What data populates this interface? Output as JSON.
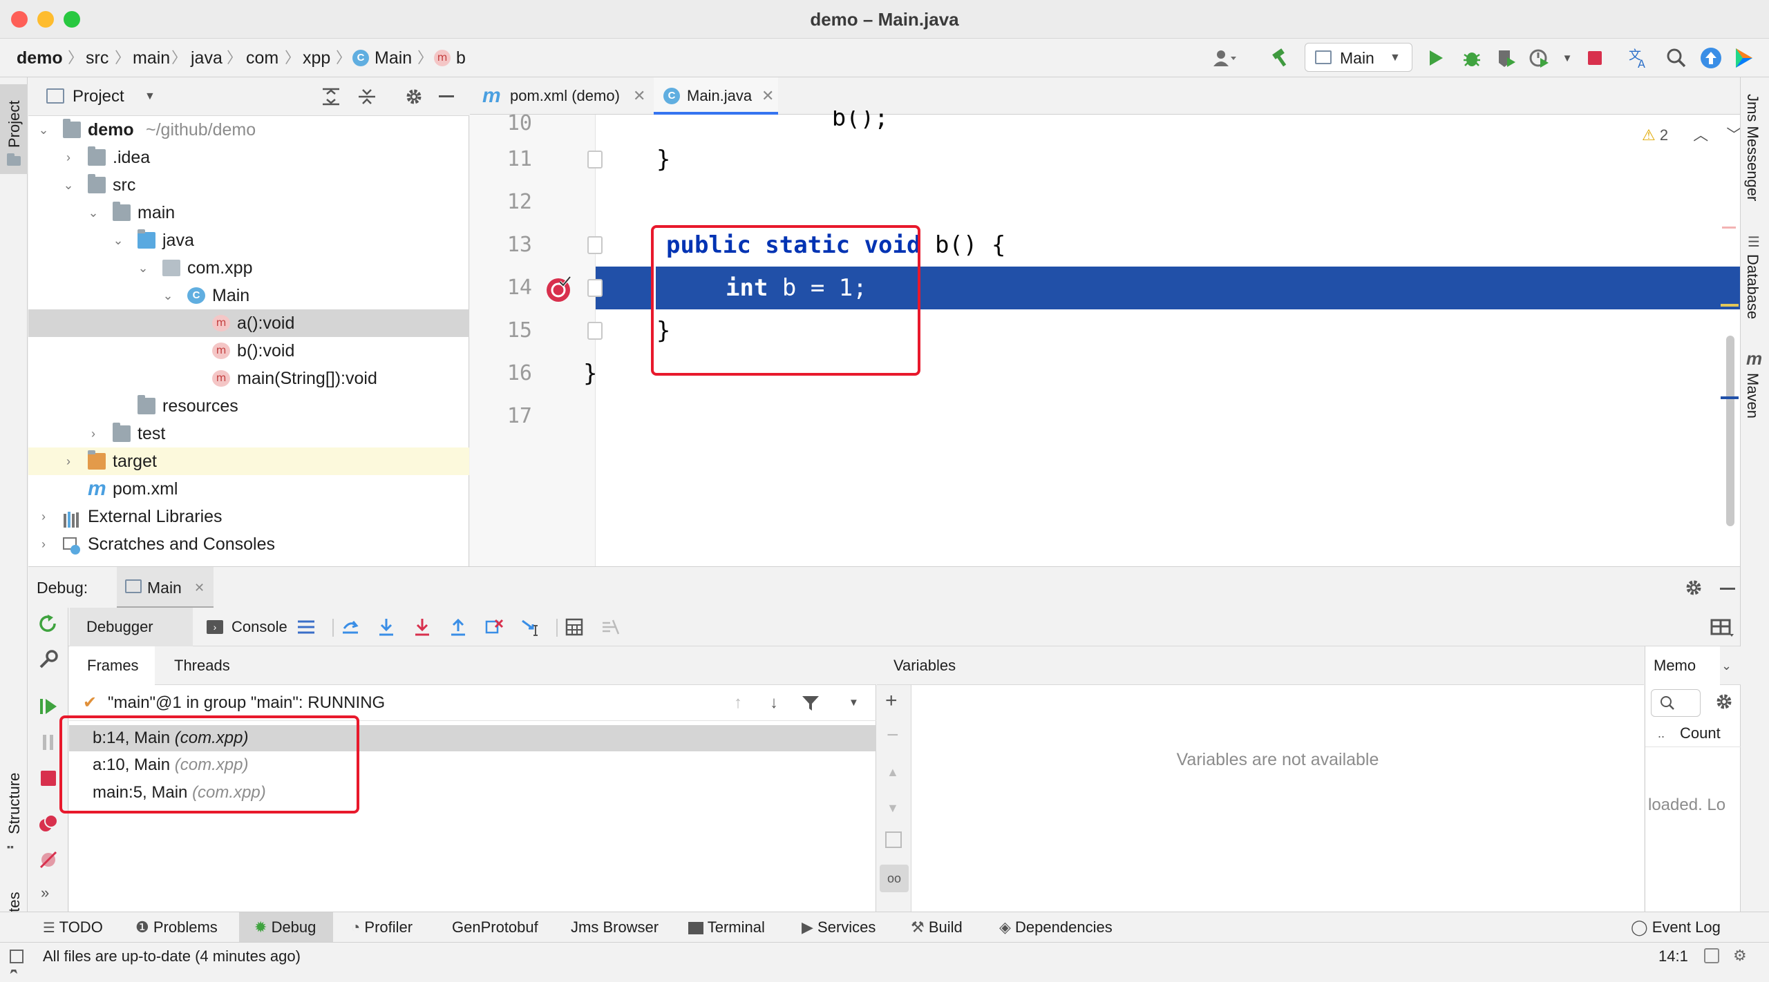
{
  "window": {
    "title": "demo – Main.java"
  },
  "breadcrumbs": [
    "demo",
    "src",
    "main",
    "java",
    "com",
    "xpp",
    "Main",
    "b"
  ],
  "toolbar": {
    "run_config": "Main"
  },
  "project_panel": {
    "title": "Project",
    "tree": [
      {
        "label": "demo",
        "suffix": "~/github/demo"
      },
      {
        "label": ".idea"
      },
      {
        "label": "src"
      },
      {
        "label": "main"
      },
      {
        "label": "java"
      },
      {
        "label": "com.xpp"
      },
      {
        "label": "Main"
      },
      {
        "label": "a():void"
      },
      {
        "label": "b():void"
      },
      {
        "label": "main(String[]):void"
      },
      {
        "label": "resources"
      },
      {
        "label": "test"
      },
      {
        "label": "target"
      },
      {
        "label": "pom.xml"
      },
      {
        "label": "External Libraries"
      },
      {
        "label": "Scratches and Consoles"
      }
    ]
  },
  "editor": {
    "tabs": [
      {
        "label": "pom.xml (demo)",
        "icon": "maven-file-icon"
      },
      {
        "label": "Main.java",
        "icon": "java-class-icon",
        "active": true
      }
    ],
    "warnings_count": "2",
    "lines": [
      {
        "num": "10",
        "code": "        b();"
      },
      {
        "num": "11",
        "code": "    }"
      },
      {
        "num": "12",
        "code": ""
      },
      {
        "num": "13",
        "kw": "public static void",
        "code": " b() {"
      },
      {
        "num": "14",
        "kw": "int",
        "code": " b = 1;"
      },
      {
        "num": "15",
        "code": "    }"
      },
      {
        "num": "16",
        "code": "}"
      },
      {
        "num": "17",
        "code": ""
      }
    ]
  },
  "debug": {
    "label": "Debug:",
    "session_tab": "Main",
    "tabs": {
      "debugger": "Debugger",
      "console": "Console"
    },
    "subtabs": {
      "frames": "Frames",
      "threads": "Threads"
    },
    "thread": "\"main\"@1 in group \"main\": RUNNING",
    "frames": [
      {
        "loc": "b:14, Main",
        "pkg": "(com.xpp)"
      },
      {
        "loc": "a:10, Main",
        "pkg": "(com.xpp)"
      },
      {
        "loc": "main:5, Main",
        "pkg": "(com.xpp)"
      }
    ],
    "variables_title": "Variables",
    "variables_empty": "Variables are not available",
    "memory_tab": "Memo",
    "memory_count": "Count",
    "memory_loaded": "loaded. Lo"
  },
  "right_stripe": [
    "Jms Messenger",
    "Database",
    "Maven"
  ],
  "left_stripe": [
    "Project",
    "Structure",
    "Favorites"
  ],
  "bottom_tabs": [
    "TODO",
    "Problems",
    "Debug",
    "Profiler",
    "GenProtobuf",
    "Jms Browser",
    "Terminal",
    "Services",
    "Build",
    "Dependencies"
  ],
  "event_log": "Event Log",
  "status": {
    "message": "All files are up-to-date (4 minutes ago)",
    "position": "14:1"
  },
  "colors": {
    "selection": "#2150a8",
    "breakpoint": "#d8304d",
    "highlight_box": "#e8192c",
    "keyword": "#0033b3"
  }
}
